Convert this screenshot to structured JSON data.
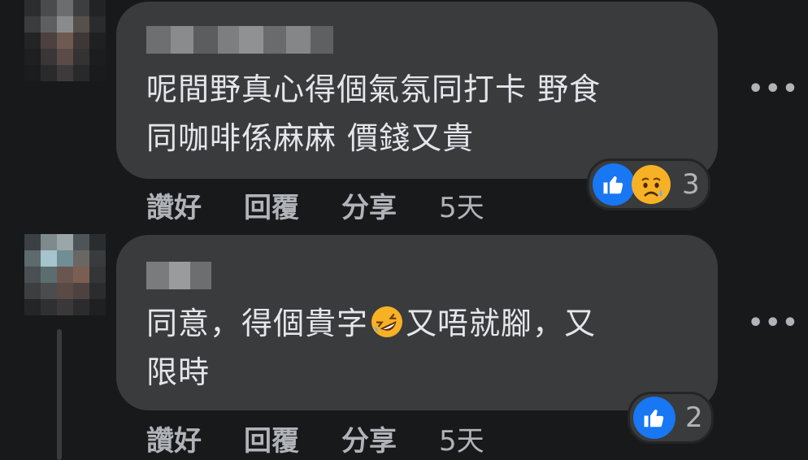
{
  "comments": [
    {
      "text": "呢間野真心得個氣氛同打卡 野食\n同咖啡係麻麻 價錢又貴",
      "actions": {
        "like": "讚好",
        "reply": "回覆",
        "share": "分享",
        "time": "5天"
      },
      "reactions": {
        "icons": [
          "like-icon",
          "sad-icon"
        ],
        "count": "3"
      },
      "more_label": "•••"
    },
    {
      "text_before_emoji": "同意，得個貴字",
      "emoji": "rolling-laughing-icon",
      "text_after_emoji": "又唔就腳，又\n限時",
      "actions": {
        "like": "讚好",
        "reply": "回覆",
        "share": "分享",
        "time": "5天"
      },
      "reactions": {
        "icons": [
          "like-icon"
        ],
        "count": "2"
      },
      "more_label": "•••"
    }
  ],
  "colors": {
    "background": "#18191a",
    "bubble": "#3a3b3c",
    "text": "#e4e6eb",
    "muted": "#b0b3b8",
    "like": "#1877f2"
  }
}
